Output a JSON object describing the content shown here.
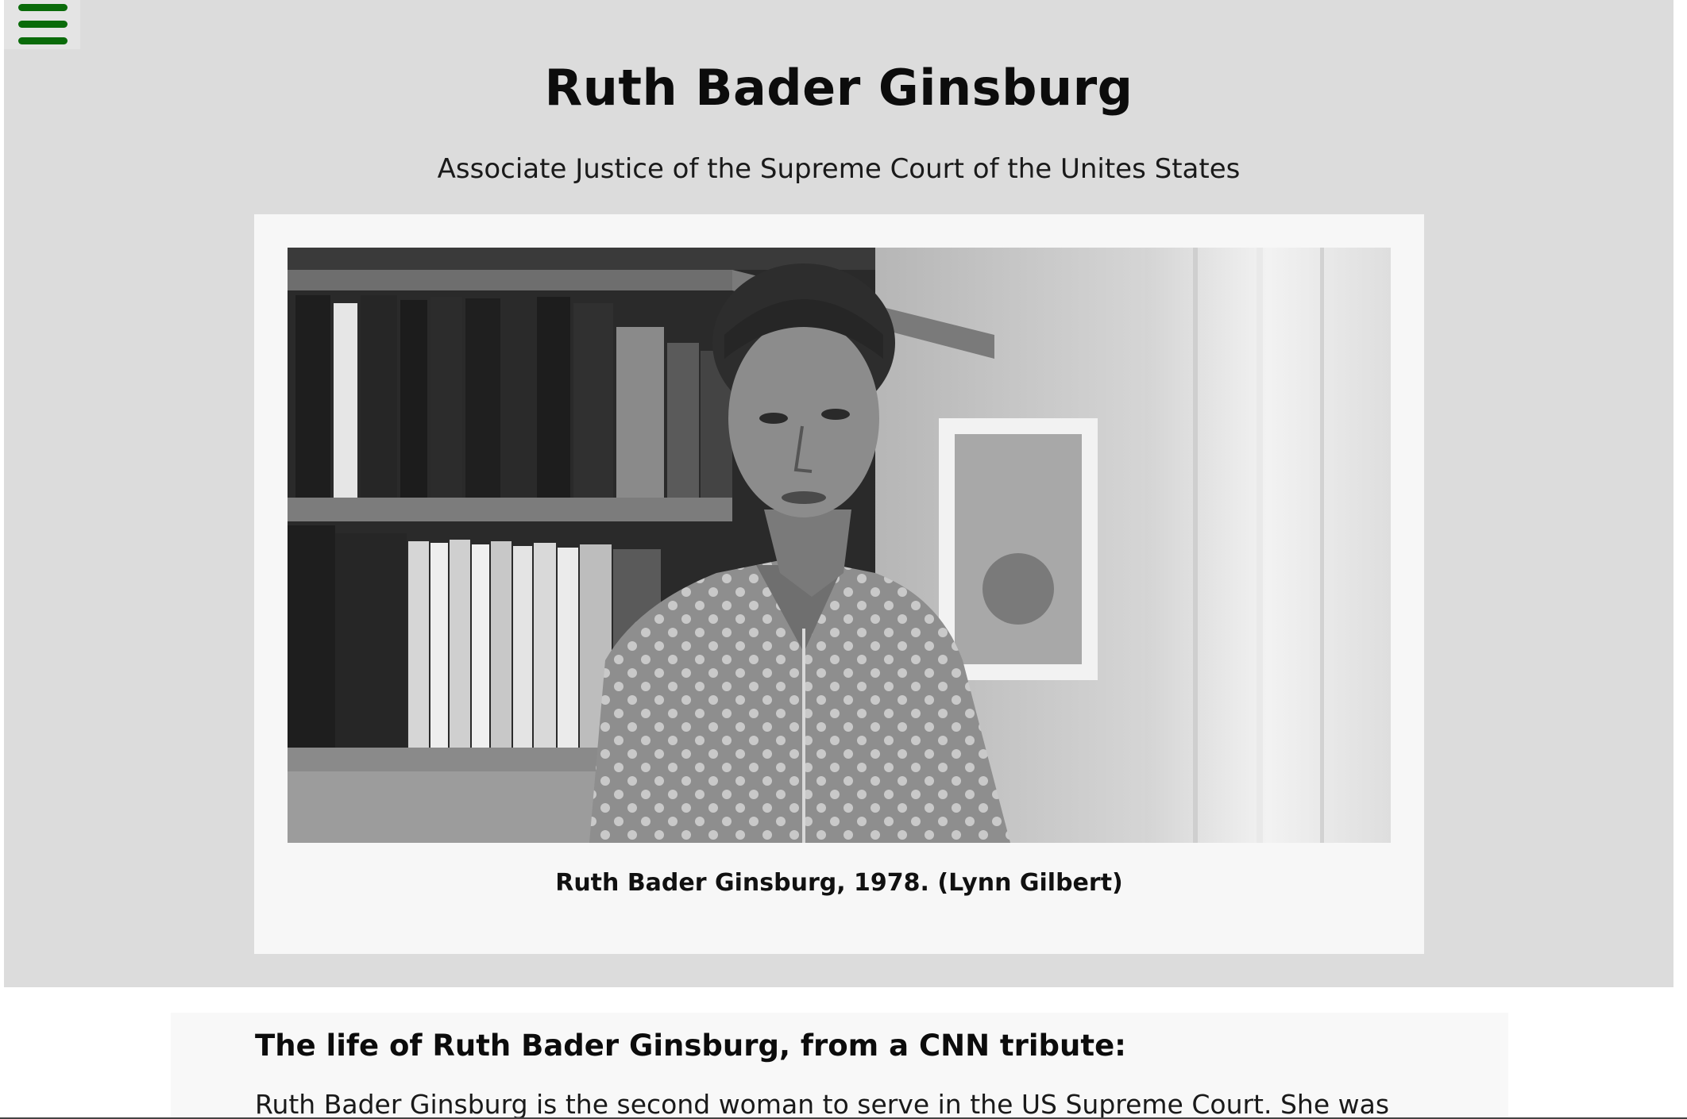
{
  "header": {
    "title": "Ruth Bader Ginsburg",
    "subtitle": "Associate Justice of the Supreme Court of the Unites States"
  },
  "menu": {
    "icon": "hamburger-menu-icon",
    "color": "#0a6b0a"
  },
  "figure": {
    "photo_description": "Black and white photograph of a woman in a polka-dot blouse standing in front of bookshelves",
    "caption": "Ruth Bader Ginsburg, 1978. (Lynn Gilbert)"
  },
  "article": {
    "heading": "The life of Ruth Bader Ginsburg, from a CNN tribute:",
    "body_first_line": "Ruth Bader Ginsburg is the second woman to serve in the US Supreme Court. She was"
  },
  "colors": {
    "hero_background": "#dcdcdc",
    "card_background": "#f7f7f7",
    "accent_green": "#0a6b0a"
  }
}
